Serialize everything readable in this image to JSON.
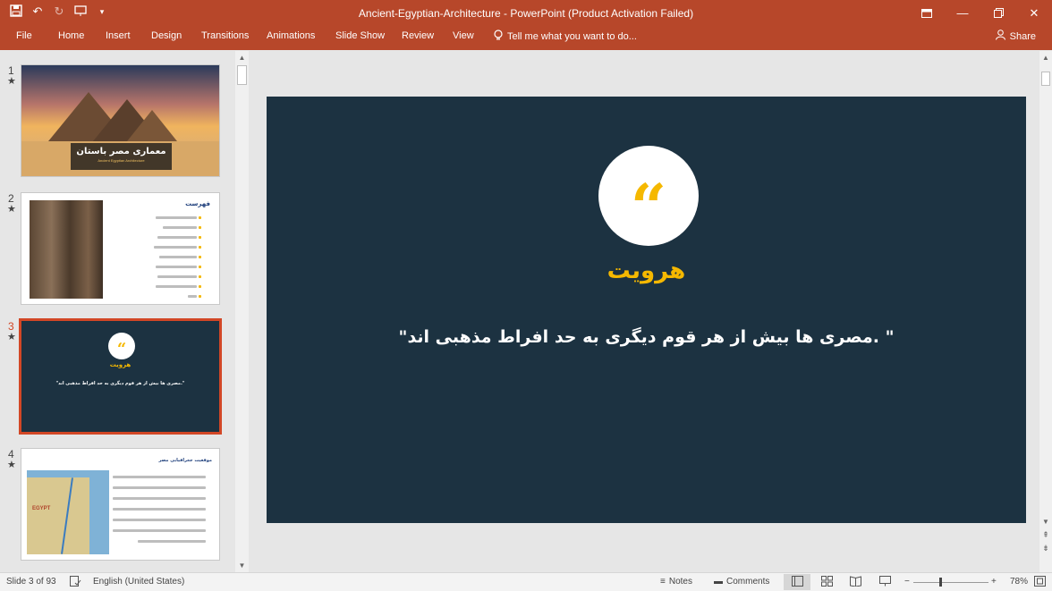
{
  "window": {
    "title": "Ancient-Egyptian-Architecture - PowerPoint (Product Activation Failed)"
  },
  "qat": {
    "save": "save-icon",
    "undo": "undo-icon",
    "redo": "redo-icon",
    "present": "present-icon",
    "customize": "▾"
  },
  "ribbon": {
    "tabs": [
      "File",
      "Home",
      "Insert",
      "Design",
      "Transitions",
      "Animations",
      "Slide Show",
      "Review",
      "View"
    ],
    "tell_me": "Tell me what you want to do...",
    "share": "Share"
  },
  "thumbnails": [
    {
      "num": "1",
      "star": "★",
      "title": "معماری مصر باستان",
      "subtitle": "Ancient Egyptian Architecture"
    },
    {
      "num": "2",
      "star": "★",
      "title": "فهرست"
    },
    {
      "num": "3",
      "star": "★",
      "title": "هرویت",
      "quote": "\"مصری ها بیش از هر قوم دیگری به حد افراط مذهبی اند.\""
    },
    {
      "num": "4",
      "star": "★",
      "title": "موقعیت جغرافیایی مصر",
      "map_label": "EGYPT"
    }
  ],
  "slide": {
    "heading": "هرویت",
    "quote": "\"مصری ها بیش از هر قوم دیگری به حد افراط مذهبی اند. \"",
    "quote_mark": "“"
  },
  "status": {
    "slide_info": "Slide 3 of 93",
    "language": "English (United States)",
    "notes": "Notes",
    "comments": "Comments",
    "zoom": "78%"
  },
  "colors": {
    "accent": "#b7472a",
    "slide_bg": "#1c3241",
    "gold": "#f5b800",
    "selected_border": "#d24726"
  }
}
